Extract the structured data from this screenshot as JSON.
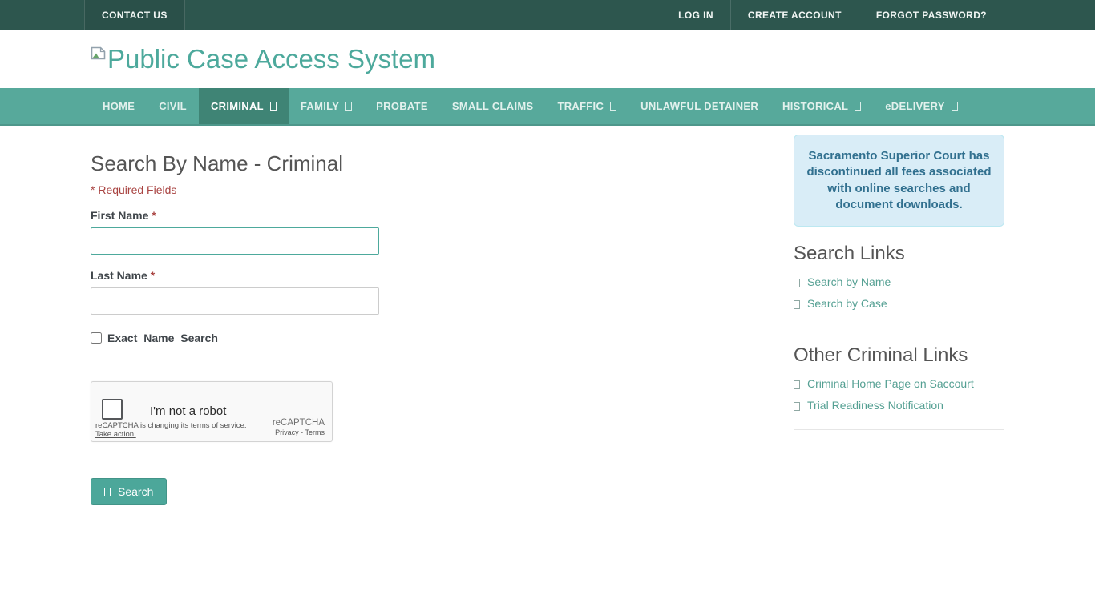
{
  "topbar": {
    "contact": "CONTACT US",
    "login": "LOG IN",
    "create_account": "CREATE ACCOUNT",
    "forgot_password": "FORGOT PASSWORD?"
  },
  "header": {
    "site_title": "Public Case Access System"
  },
  "nav": {
    "items": [
      {
        "label": "HOME",
        "active": false,
        "caret": false
      },
      {
        "label": "CIVIL",
        "active": false,
        "caret": false
      },
      {
        "label": "CRIMINAL",
        "active": true,
        "caret": true
      },
      {
        "label": "FAMILY",
        "active": false,
        "caret": true
      },
      {
        "label": "PROBATE",
        "active": false,
        "caret": false
      },
      {
        "label": "SMALL CLAIMS",
        "active": false,
        "caret": false
      },
      {
        "label": "TRAFFIC",
        "active": false,
        "caret": true
      },
      {
        "label": "UNLAWFUL DETAINER",
        "active": false,
        "caret": false
      },
      {
        "label": "HISTORICAL",
        "active": false,
        "caret": true
      },
      {
        "label": "eDELIVERY",
        "active": false,
        "caret": true
      }
    ]
  },
  "main": {
    "title": "Search By Name - Criminal",
    "required_note": "* Required Fields",
    "form": {
      "first_name": {
        "label": "First Name",
        "required_marker": "*",
        "value": ""
      },
      "last_name": {
        "label": "Last Name",
        "required_marker": "*",
        "value": ""
      },
      "exact_name_label": "Exact Name Search",
      "search_button": "Search"
    },
    "recaptcha": {
      "checkbox_label": "I'm not a robot",
      "notice": "reCAPTCHA is changing its terms of service.",
      "notice_action": "Take action.",
      "brand": "reCAPTCHA",
      "privacy": "Privacy",
      "separator": "-",
      "terms": "Terms"
    }
  },
  "sidebar": {
    "notice": "Sacramento Superior Court has discontinued all fees associated with online searches and document downloads.",
    "search_links": {
      "title": "Search Links",
      "links": [
        "Search by Name",
        "Search by Case"
      ]
    },
    "other_links": {
      "title": "Other Criminal Links",
      "links": [
        "Criminal Home Page on Saccourt",
        "Trial Readiness Notification"
      ]
    }
  },
  "colors": {
    "topbar_bg": "#2d564e",
    "nav_bg": "#57a99b",
    "nav_active_bg": "#3f8475",
    "brand_teal": "#4da99c",
    "link_teal": "#55a093",
    "button_bg": "#4ca79a",
    "alert_bg": "#d9edf7",
    "alert_border": "#bce8f1",
    "alert_text": "#31708f",
    "required_red": "#a94442"
  }
}
